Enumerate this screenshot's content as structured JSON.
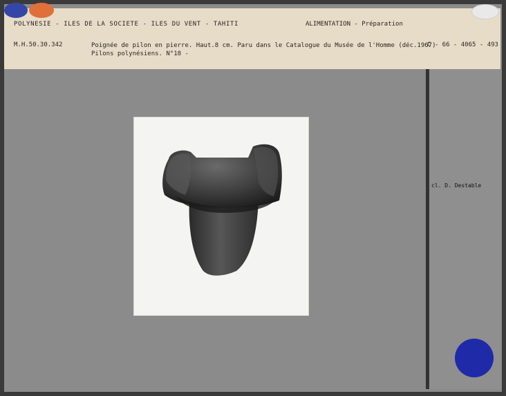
{
  "header": {
    "location_line": "POLYNESIE - ILES DE LA SOCIETE - ILES DU VENT - TAHITI",
    "category_line": "ALIMENTATION - Préparation",
    "inventory_number": "M.H.50.30.342",
    "description_line1": "Poignée de pilon en pierre. Haut.8 cm. Paru dans le Catalogue du Musée de l'Homme (déc.1967)",
    "description_line2": "Pilons polynésiens. N°18 -",
    "reference": "C - 66 - 4065 - 493"
  },
  "sidebar": {
    "credit": "cl. D. Destable"
  },
  "colors": {
    "header_bg": "#e7dcc8",
    "card_bg": "#8b8b8b",
    "stamp_blue": "#1f2aa8",
    "dot_orange": "#e06f3a"
  }
}
